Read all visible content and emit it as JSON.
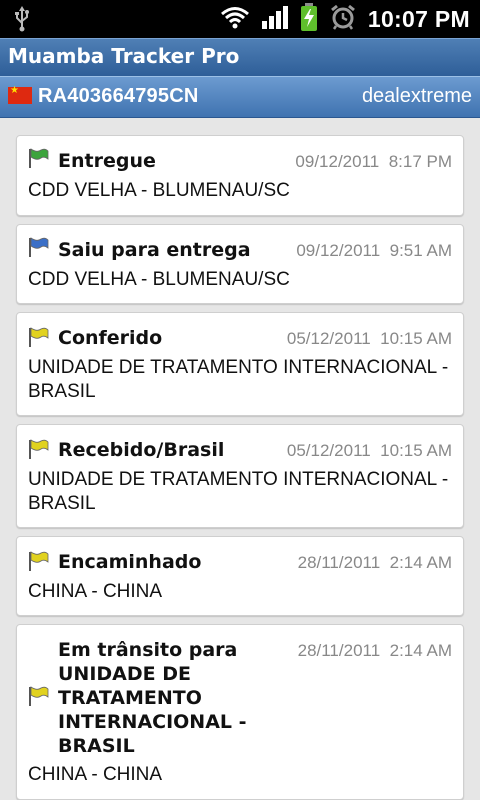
{
  "status_bar": {
    "time": "10:07 PM"
  },
  "app": {
    "title": "Muamba Tracker Pro"
  },
  "package": {
    "code": "RA403664795CN",
    "store": "dealextreme",
    "origin_flag": "china-flag"
  },
  "events": [
    {
      "status": "Entregue",
      "date": "09/12/2011",
      "time": "8:17 PM",
      "location": "CDD VELHA - BLUMENAU/SC",
      "flag_color": "#3da43d"
    },
    {
      "status": "Saiu para entrega",
      "date": "09/12/2011",
      "time": "9:51 AM",
      "location": "CDD VELHA - BLUMENAU/SC",
      "flag_color": "#3b6fc7"
    },
    {
      "status": "Conferido",
      "date": "05/12/2011",
      "time": "10:15 AM",
      "location": "UNIDADE DE TRATAMENTO INTERNACIONAL - BRASIL",
      "flag_color": "#e1d21f"
    },
    {
      "status": "Recebido/Brasil",
      "date": "05/12/2011",
      "time": "10:15 AM",
      "location": "UNIDADE DE TRATAMENTO INTERNACIONAL - BRASIL",
      "flag_color": "#e1d21f"
    },
    {
      "status": "Encaminhado",
      "date": "28/11/2011",
      "time": "2:14 AM",
      "location": "CHINA - CHINA",
      "flag_color": "#e1d21f"
    },
    {
      "status": "Em trânsito para UNIDADE DE TRATAMENTO INTERNACIONAL - BRASIL",
      "date": "28/11/2011",
      "time": "2:14 AM",
      "location": "CHINA - CHINA",
      "flag_color": "#e1d21f"
    }
  ]
}
